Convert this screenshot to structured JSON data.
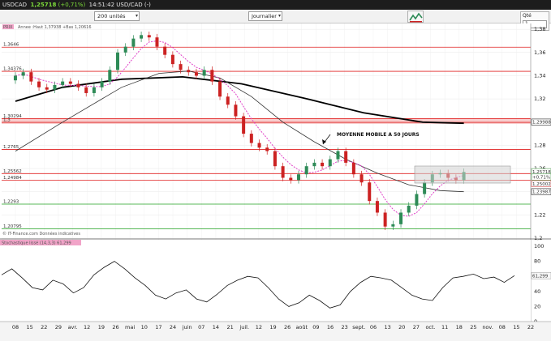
{
  "window": {
    "symbol": "USDCAD",
    "price": "1,25718",
    "change": "(+0,71%)",
    "time_symbol": "14:51:42 USD/CAD (-)"
  },
  "toolbar": {
    "units_value": "200 unités",
    "period_value": "Journalier",
    "qty_label": "Qté",
    "qty_value": "1"
  },
  "legend": {
    "series_tag": "PRIX",
    "year_info": "Annee :Haut 1,37938 +Bas 1,20616"
  },
  "annotation": "MOYENNE MOBILE A 50 JOURS",
  "source_note": "© IT-Finance.com Données indicatives",
  "oscillator_header": "Stochastique lissé (14,3,3) 61,299",
  "colors": {
    "candle_up": "#2e8b57",
    "candle_down": "#cc2222",
    "sma_fast": "#e040c8",
    "sma_50": "#333333",
    "sma_200": "#000000",
    "resistance": "#e02020",
    "support": "#20a020"
  },
  "chart_data": [
    {
      "type": "candlestick",
      "series": [
        {
          "name": "USDCAD",
          "x": [
            "2021-03-08",
            "2021-03-12",
            "2021-03-16",
            "2021-03-20",
            "2021-03-24",
            "2021-03-28",
            "2021-04-01",
            "2021-04-05",
            "2021-04-09",
            "2021-04-13",
            "2021-04-17",
            "2021-04-21",
            "2021-04-25",
            "2021-04-29",
            "2021-05-03",
            "2021-05-07",
            "2021-05-11",
            "2021-05-15",
            "2021-05-19",
            "2021-05-23",
            "2021-05-27",
            "2021-05-31",
            "2021-06-04",
            "2021-06-08",
            "2021-06-12",
            "2021-06-16",
            "2021-06-20",
            "2021-06-24",
            "2021-06-28",
            "2021-07-02",
            "2021-07-06",
            "2021-07-10",
            "2021-07-14",
            "2021-07-18",
            "2021-07-22",
            "2021-07-26",
            "2021-07-30",
            "2021-08-03",
            "2021-08-07",
            "2021-08-11",
            "2021-08-15",
            "2021-08-19",
            "2021-08-23",
            "2021-08-27",
            "2021-08-31",
            "2021-09-04",
            "2021-09-08",
            "2021-09-12",
            "2021-09-16",
            "2021-09-20",
            "2021-09-24",
            "2021-09-28",
            "2021-10-02",
            "2021-10-06",
            "2021-10-10",
            "2021-10-14",
            "2021-10-18",
            "2021-10-22"
          ],
          "values": [
            1.34,
            1.343,
            1.335,
            1.33,
            1.328,
            1.332,
            1.335,
            1.333,
            1.33,
            1.325,
            1.33,
            1.335,
            1.345,
            1.36,
            1.365,
            1.372,
            1.375,
            1.373,
            1.365,
            1.358,
            1.35,
            1.345,
            1.343,
            1.34,
            1.345,
            1.335,
            1.322,
            1.315,
            1.305,
            1.29,
            1.282,
            1.278,
            1.275,
            1.262,
            1.252,
            1.25,
            1.255,
            1.262,
            1.265,
            1.262,
            1.268,
            1.275,
            1.265,
            1.255,
            1.248,
            1.232,
            1.222,
            1.21,
            1.212,
            1.222,
            1.228,
            1.238,
            1.248,
            1.255,
            1.256,
            1.252,
            1.25,
            1.257
          ]
        },
        {
          "name": "Moyenne mobile 50 jours",
          "x": [
            "2021-03-08",
            "2021-04-01",
            "2021-05-01",
            "2021-05-20",
            "2021-06-04",
            "2021-06-20",
            "2021-07-06",
            "2021-07-22",
            "2021-08-07",
            "2021-08-23",
            "2021-09-08",
            "2021-09-24",
            "2021-10-10",
            "2021-10-22"
          ],
          "values": [
            1.275,
            1.3,
            1.33,
            1.342,
            1.344,
            1.338,
            1.322,
            1.3,
            1.283,
            1.268,
            1.256,
            1.246,
            1.241,
            1.24
          ]
        },
        {
          "name": "Moyenne mobile 200 jours",
          "x": [
            "2021-03-08",
            "2021-04-01",
            "2021-05-01",
            "2021-06-01",
            "2021-07-01",
            "2021-08-01",
            "2021-09-01",
            "2021-10-01",
            "2021-10-22"
          ],
          "values": [
            1.318,
            1.33,
            1.337,
            1.339,
            1.333,
            1.321,
            1.308,
            1.3,
            1.299
          ]
        }
      ],
      "y_ticks": [
        "1,38",
        "1,36",
        "1,34",
        "1,32",
        "1,3",
        "1,28",
        "1,26",
        "1,24",
        "1,22",
        "1,2"
      ],
      "x_ticks": [
        "08",
        "15",
        "22",
        "29",
        "avr.",
        "12",
        "19",
        "26",
        "mai",
        "10",
        "17",
        "24",
        "juin",
        "07",
        "14",
        "21",
        "juil.",
        "12",
        "19",
        "26",
        "août",
        "09",
        "16",
        "23",
        "sept.",
        "06",
        "13",
        "20",
        "27",
        "oct.",
        "11",
        "18",
        "25",
        "nov.",
        "08",
        "15",
        "22"
      ],
      "price_levels": [
        {
          "label": "1,3646",
          "value": 1.3646,
          "style": "resistance"
        },
        {
          "label": "1,34376",
          "value": 1.34376,
          "style": "resistance"
        },
        {
          "label": "1,30294",
          "value": 1.30294,
          "style": "resistance"
        },
        {
          "label": "1,3",
          "value": 1.2998,
          "style": "zone"
        },
        {
          "label": "1,2765",
          "value": 1.2765,
          "style": "resistance"
        },
        {
          "label": "1,25562",
          "value": 1.25562,
          "style": "resistance"
        },
        {
          "label": "1,24984",
          "value": 1.24984,
          "style": "resistance"
        },
        {
          "label": "1,2293",
          "value": 1.2293,
          "style": "support"
        },
        {
          "label": "1,20795",
          "value": 1.20795,
          "style": "support"
        }
      ],
      "right_labels": [
        {
          "text": "1,29988",
          "value": 1.29988,
          "color": "#000000"
        },
        {
          "text": "1,25718",
          "value": 1.25718,
          "color": "#2a8a2a"
        },
        {
          "text": "+0,71%",
          "value": 1.2525,
          "color": "#2a8a2a"
        },
        {
          "text": "1,25002",
          "value": 1.2468,
          "color": "#cc2222"
        },
        {
          "text": "1,23987",
          "value": 1.23987,
          "color": "#000000"
        }
      ],
      "ylim": [
        1.2,
        1.385
      ],
      "title": "",
      "xlabel": "",
      "ylabel": ""
    },
    {
      "type": "line",
      "series": [
        {
          "name": "Stochastique",
          "x": [
            0,
            2,
            4,
            6,
            8,
            10,
            12,
            14,
            16,
            18,
            20,
            22,
            24,
            26,
            28,
            30,
            32,
            34,
            36,
            38,
            40,
            42,
            44,
            46,
            48,
            50,
            52,
            54,
            56,
            58,
            60,
            62,
            64,
            66,
            68,
            70,
            72,
            74,
            76,
            78,
            80,
            82,
            84,
            86,
            88,
            90,
            92,
            94,
            96,
            98,
            100
          ],
          "values": [
            62,
            70,
            58,
            45,
            42,
            55,
            50,
            38,
            45,
            62,
            72,
            80,
            70,
            58,
            48,
            35,
            30,
            38,
            42,
            30,
            26,
            36,
            48,
            55,
            60,
            58,
            45,
            30,
            20,
            25,
            35,
            28,
            18,
            22,
            40,
            52,
            60,
            58,
            55,
            45,
            35,
            30,
            28,
            45,
            58,
            60,
            63,
            57,
            59,
            52,
            61
          ]
        }
      ],
      "y_ticks": [
        "100",
        "80",
        "60",
        "40",
        "20",
        "0"
      ],
      "ylim": [
        0,
        100
      ],
      "current_value": "61,299",
      "title": "",
      "xlabel": "",
      "ylabel": ""
    }
  ]
}
